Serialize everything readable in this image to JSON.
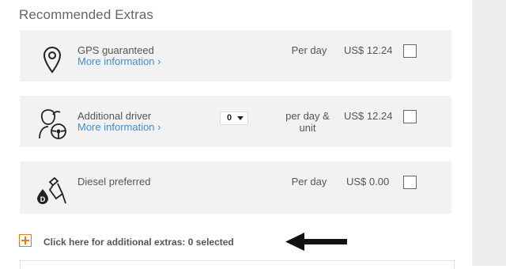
{
  "section": {
    "title": "Recommended Extras"
  },
  "extras": [
    {
      "name": "GPS guaranteed",
      "more": "More information ›",
      "unit": "Per day",
      "price": "US$ 12.24",
      "icon": "map-pin-icon",
      "checked": false
    },
    {
      "name": "Additional driver",
      "more": "More information ›",
      "unit": "per day & unit",
      "price": "US$ 12.24",
      "icon": "driver-icon",
      "checked": false,
      "quantity": "0"
    },
    {
      "name": "Diesel preferred",
      "unit": "Per day",
      "price": "US$ 0.00",
      "icon": "diesel-fuel-icon",
      "checked": false
    }
  ],
  "more_extras": {
    "label": "Click here for additional extras: 0 selected",
    "icon": "plus-icon"
  },
  "annotation": {
    "icon": "arrow-left-icon"
  },
  "colors": {
    "card_bg": "#f2f2f2",
    "link": "#3d8fd6",
    "accent": "#e27a1b",
    "side_panel": "#eeeeee"
  }
}
